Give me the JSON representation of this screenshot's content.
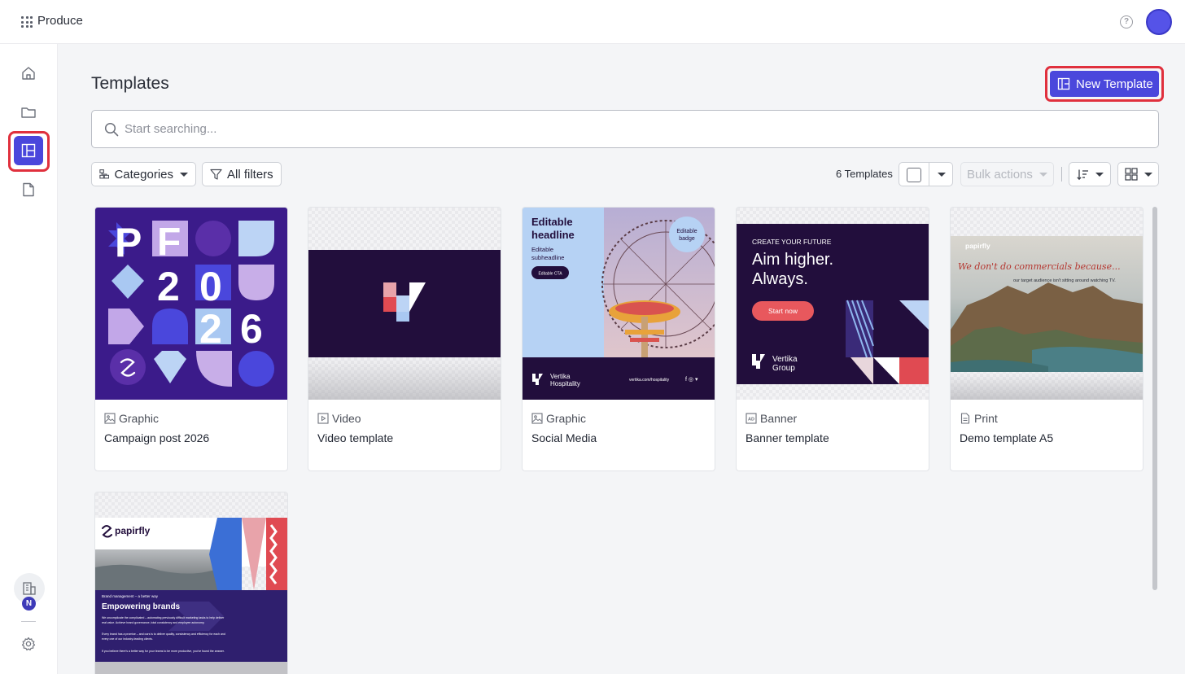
{
  "header": {
    "app_name": "Produce",
    "apps_icon": "grid-icon",
    "help_icon": "help-circle-icon",
    "help_glyph": "?"
  },
  "sidebar": {
    "items": [
      {
        "name": "home",
        "icon": "home-icon"
      },
      {
        "name": "folder",
        "icon": "folder-icon"
      },
      {
        "name": "templates",
        "icon": "templates-icon",
        "active": true
      },
      {
        "name": "documents",
        "icon": "document-icon"
      }
    ],
    "org_icon": "building-icon",
    "org_badge": "N",
    "settings_icon": "gear-icon"
  },
  "main": {
    "title": "Templates",
    "new_button": "New Template",
    "search_placeholder": "Start searching...",
    "categories_label": "Categories",
    "filters_label": "All filters",
    "count_label": "6 Templates",
    "bulk_label": "Bulk actions"
  },
  "templates": [
    {
      "type": "Graphic",
      "type_icon": "image-icon",
      "name": "Campaign post 2026"
    },
    {
      "type": "Video",
      "type_icon": "video-icon",
      "name": "Video template"
    },
    {
      "type": "Graphic",
      "type_icon": "image-icon",
      "name": "Social Media"
    },
    {
      "type": "Banner",
      "type_icon": "ad-icon",
      "name": "Banner template"
    },
    {
      "type": "Print",
      "type_icon": "document-icon",
      "name": "Demo template A5"
    },
    {
      "type": "",
      "type_icon": "",
      "name": ""
    }
  ],
  "thumbnails": {
    "campaign": {
      "letters": [
        "P",
        "F",
        "2",
        "0",
        "2",
        "6"
      ]
    },
    "social": {
      "headline": "Editable headline",
      "subheadline": "Editable subheadline",
      "cta": "Editable CTA",
      "badge": "Editable badge",
      "brand": "Vertika Hospitality",
      "url": "vertika.com/hospitality",
      "social_icons": "f ◎ ▾"
    },
    "banner": {
      "eyebrow": "CREATE YOUR FUTURE",
      "headline_line1": "Aim higher.",
      "headline_line2": "Always.",
      "cta": "Start now",
      "brand_line1": "Vertika",
      "brand_line2": "Group"
    },
    "print_a5": {
      "brand": "papirfly",
      "headline": "We don't do commercials because...",
      "sub": "our target audience isn't sitting around watching TV."
    },
    "sixth": {
      "brand": "papirfly",
      "kicker": "Brand management – a better way",
      "headline": "Empowering brands",
      "body1": "We uncomplicate the complicated – automating previously difficult marketing tasks to help deliver real value. Achieve brand governance, total consistency and employee autonomy.",
      "body2": "Every brand has a promise – and ours is to deliver quality, consistency and efficiency for each and every one of our industry-leading clients.",
      "body3": "If you believe there's a better way for your teams to be more productive, you've found the answer."
    }
  },
  "colors": {
    "accent": "#4a47dc",
    "highlight_ring": "#e0303d",
    "dark_purple": "#220e3c"
  }
}
